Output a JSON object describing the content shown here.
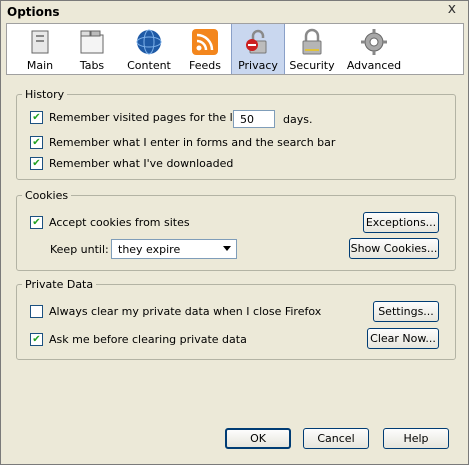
{
  "window": {
    "title": "Options",
    "close_glyph": "x"
  },
  "tabs": [
    {
      "label": "Main",
      "icon": "main-icon"
    },
    {
      "label": "Tabs",
      "icon": "tabs-icon"
    },
    {
      "label": "Content",
      "icon": "globe-icon"
    },
    {
      "label": "Feeds",
      "icon": "rss-icon"
    },
    {
      "label": "Privacy",
      "icon": "privacy-icon",
      "selected": true
    },
    {
      "label": "Security",
      "icon": "lock-icon"
    },
    {
      "label": "Advanced",
      "icon": "gear-icon"
    }
  ],
  "history": {
    "legend": "History",
    "remember_visited_label": "Remember visited pages for the last",
    "remember_visited_value": "50",
    "days_label": "days.",
    "remember_visited_checked": true,
    "remember_forms_label": "Remember what I enter in forms and the search bar",
    "remember_forms_checked": true,
    "remember_downloads_label": "Remember what I've downloaded",
    "remember_downloads_checked": true
  },
  "cookies": {
    "legend": "Cookies",
    "accept_label": "Accept cookies from sites",
    "accept_checked": true,
    "exceptions_button": "Exceptions...",
    "keep_until_label": "Keep until:",
    "keep_until_value": "they expire",
    "show_cookies_button": "Show Cookies..."
  },
  "private_data": {
    "legend": "Private Data",
    "always_clear_label": "Always clear my private data when I close Firefox",
    "always_clear_checked": false,
    "settings_button": "Settings...",
    "ask_before_label": "Ask me before clearing private data",
    "ask_before_checked": true,
    "clear_now_button": "Clear Now..."
  },
  "footer": {
    "ok": "OK",
    "cancel": "Cancel",
    "help": "Help"
  },
  "check_glyph": "✔",
  "colors": {
    "selected_tab": "#c9d7ef",
    "dialog_bg": "#ece9d8",
    "check": "#21a121"
  }
}
